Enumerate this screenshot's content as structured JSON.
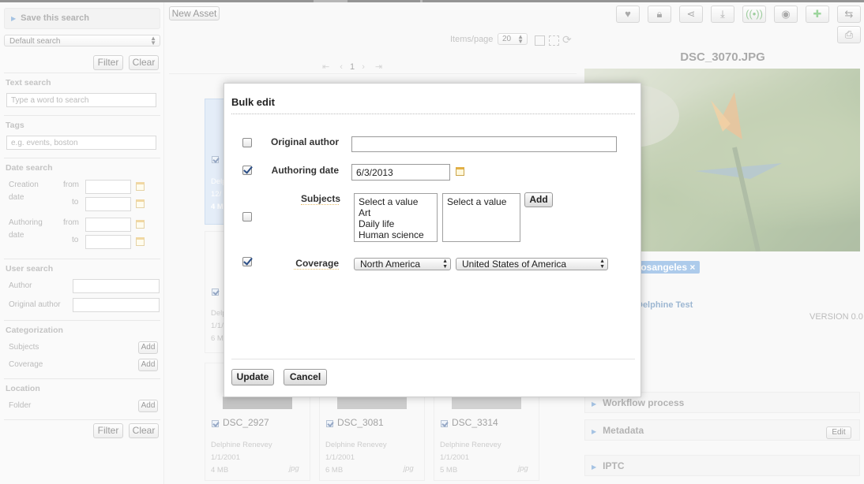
{
  "sidebar": {
    "save_search": "Save this search",
    "default_search": "Default search",
    "filter": "Filter",
    "clear": "Clear",
    "text_search": {
      "title": "Text search",
      "placeholder": "Type a word to search"
    },
    "tags": {
      "title": "Tags",
      "placeholder": "e.g. events, boston"
    },
    "date_search": {
      "title": "Date search",
      "creation": "Creation",
      "date": "date",
      "authoring": "Authoring",
      "from": "from",
      "to": "to"
    },
    "user_search": {
      "title": "User search",
      "author": "Author",
      "original_author": "Original author"
    },
    "categorization": {
      "title": "Categorization",
      "subjects": "Subjects",
      "coverage": "Coverage",
      "add": "Add"
    },
    "location": {
      "title": "Location",
      "folder": "Folder",
      "add": "Add"
    }
  },
  "main": {
    "new_asset": "New Asset",
    "items_per_page_label": "Items/page",
    "items_per_page_value": "20",
    "current_page": "1",
    "cards": [
      {
        "title": "DSC_2927",
        "author": "Delphine Renevey",
        "date": "1/1/2001",
        "size": "4 MB",
        "ext": "jpg"
      },
      {
        "title": "DSC_3081",
        "author": "Delphine Renevey",
        "date": "1/1/2001",
        "size": "6 MB",
        "ext": "jpg"
      },
      {
        "title": "DSC_3314",
        "author": "Delphine Renevey",
        "date": "1/1/2001",
        "size": "5 MB",
        "ext": "jpg"
      }
    ],
    "partial_card_top": {
      "author": "Delp",
      "date": "12/",
      "size": "4 M"
    },
    "partial_card_mid": {
      "author": "Delphine",
      "date": "1/1/",
      "size": "6 M"
    }
  },
  "right": {
    "asset_title": "DSC_3070.JPG",
    "tag": "losangeles",
    "tag_remove": "×",
    "author": "Delphine Test",
    "version": "VERSION 0.0",
    "workflow": "Workflow process",
    "metadata": "Metadata",
    "edit": "Edit",
    "iptc": "IPTC"
  },
  "dialog": {
    "title": "Bulk edit",
    "original_author": {
      "label": "Original author",
      "value": "",
      "checked": false
    },
    "authoring_date": {
      "label": "Authoring date",
      "value": "6/3/2013",
      "checked": true
    },
    "subjects": {
      "label": "Subjects",
      "checked": false,
      "options": [
        "Select a value",
        "Art",
        "Daily life",
        "Human science"
      ],
      "selected": [
        "Select a value"
      ],
      "add": "Add"
    },
    "coverage": {
      "label": "Coverage",
      "region": "North America",
      "country": "United States of America",
      "checked": true
    },
    "update": "Update",
    "cancel": "Cancel"
  }
}
